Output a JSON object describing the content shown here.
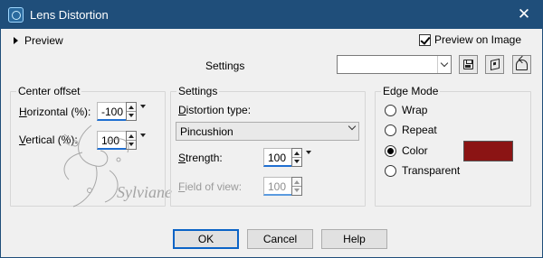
{
  "window": {
    "title": "Lens Distortion"
  },
  "preview": {
    "toggle_label": "Preview",
    "preview_on_image_label": "Preview on Image",
    "preview_on_image_checked": true
  },
  "presets": {
    "label": "Settings",
    "value": ""
  },
  "center_offset": {
    "title": "Center offset",
    "horizontal_label": "Horizontal (%):",
    "horizontal_value": "-100",
    "vertical_label": "Vertical (%):",
    "vertical_value": "100"
  },
  "settings_group": {
    "title": "Settings",
    "distortion_type_label": "Distortion type:",
    "distortion_type_value": "Pincushion",
    "strength_label": "Strength:",
    "strength_value": "100",
    "field_of_view_label": "Field of view:",
    "field_of_view_value": "100"
  },
  "edge_mode": {
    "title": "Edge Mode",
    "options": [
      "Wrap",
      "Repeat",
      "Color",
      "Transparent"
    ],
    "selected": "Color",
    "color_hex": "#8b1414"
  },
  "watermark": {
    "text": "Sylviane"
  },
  "buttons": {
    "ok": "OK",
    "cancel": "Cancel",
    "help": "Help"
  },
  "colors": {
    "titlebar": "#1f4e7a",
    "dialog_bg": "#f0f0f0",
    "focus_blue": "#0a63c6"
  }
}
